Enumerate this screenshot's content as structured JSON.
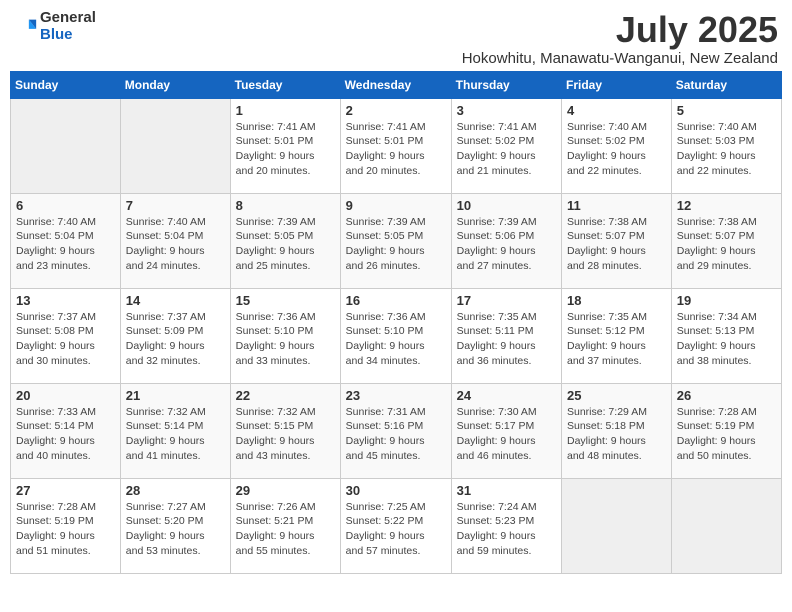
{
  "header": {
    "logo": {
      "line1": "General",
      "line2": "Blue"
    },
    "month": "July 2025",
    "location": "Hokowhitu, Manawatu-Wanganui, New Zealand"
  },
  "columns": [
    "Sunday",
    "Monday",
    "Tuesday",
    "Wednesday",
    "Thursday",
    "Friday",
    "Saturday"
  ],
  "weeks": [
    [
      {
        "day": "",
        "info": ""
      },
      {
        "day": "",
        "info": ""
      },
      {
        "day": "1",
        "info": "Sunrise: 7:41 AM\nSunset: 5:01 PM\nDaylight: 9 hours\nand 20 minutes."
      },
      {
        "day": "2",
        "info": "Sunrise: 7:41 AM\nSunset: 5:01 PM\nDaylight: 9 hours\nand 20 minutes."
      },
      {
        "day": "3",
        "info": "Sunrise: 7:41 AM\nSunset: 5:02 PM\nDaylight: 9 hours\nand 21 minutes."
      },
      {
        "day": "4",
        "info": "Sunrise: 7:40 AM\nSunset: 5:02 PM\nDaylight: 9 hours\nand 22 minutes."
      },
      {
        "day": "5",
        "info": "Sunrise: 7:40 AM\nSunset: 5:03 PM\nDaylight: 9 hours\nand 22 minutes."
      }
    ],
    [
      {
        "day": "6",
        "info": "Sunrise: 7:40 AM\nSunset: 5:04 PM\nDaylight: 9 hours\nand 23 minutes."
      },
      {
        "day": "7",
        "info": "Sunrise: 7:40 AM\nSunset: 5:04 PM\nDaylight: 9 hours\nand 24 minutes."
      },
      {
        "day": "8",
        "info": "Sunrise: 7:39 AM\nSunset: 5:05 PM\nDaylight: 9 hours\nand 25 minutes."
      },
      {
        "day": "9",
        "info": "Sunrise: 7:39 AM\nSunset: 5:05 PM\nDaylight: 9 hours\nand 26 minutes."
      },
      {
        "day": "10",
        "info": "Sunrise: 7:39 AM\nSunset: 5:06 PM\nDaylight: 9 hours\nand 27 minutes."
      },
      {
        "day": "11",
        "info": "Sunrise: 7:38 AM\nSunset: 5:07 PM\nDaylight: 9 hours\nand 28 minutes."
      },
      {
        "day": "12",
        "info": "Sunrise: 7:38 AM\nSunset: 5:07 PM\nDaylight: 9 hours\nand 29 minutes."
      }
    ],
    [
      {
        "day": "13",
        "info": "Sunrise: 7:37 AM\nSunset: 5:08 PM\nDaylight: 9 hours\nand 30 minutes."
      },
      {
        "day": "14",
        "info": "Sunrise: 7:37 AM\nSunset: 5:09 PM\nDaylight: 9 hours\nand 32 minutes."
      },
      {
        "day": "15",
        "info": "Sunrise: 7:36 AM\nSunset: 5:10 PM\nDaylight: 9 hours\nand 33 minutes."
      },
      {
        "day": "16",
        "info": "Sunrise: 7:36 AM\nSunset: 5:10 PM\nDaylight: 9 hours\nand 34 minutes."
      },
      {
        "day": "17",
        "info": "Sunrise: 7:35 AM\nSunset: 5:11 PM\nDaylight: 9 hours\nand 36 minutes."
      },
      {
        "day": "18",
        "info": "Sunrise: 7:35 AM\nSunset: 5:12 PM\nDaylight: 9 hours\nand 37 minutes."
      },
      {
        "day": "19",
        "info": "Sunrise: 7:34 AM\nSunset: 5:13 PM\nDaylight: 9 hours\nand 38 minutes."
      }
    ],
    [
      {
        "day": "20",
        "info": "Sunrise: 7:33 AM\nSunset: 5:14 PM\nDaylight: 9 hours\nand 40 minutes."
      },
      {
        "day": "21",
        "info": "Sunrise: 7:32 AM\nSunset: 5:14 PM\nDaylight: 9 hours\nand 41 minutes."
      },
      {
        "day": "22",
        "info": "Sunrise: 7:32 AM\nSunset: 5:15 PM\nDaylight: 9 hours\nand 43 minutes."
      },
      {
        "day": "23",
        "info": "Sunrise: 7:31 AM\nSunset: 5:16 PM\nDaylight: 9 hours\nand 45 minutes."
      },
      {
        "day": "24",
        "info": "Sunrise: 7:30 AM\nSunset: 5:17 PM\nDaylight: 9 hours\nand 46 minutes."
      },
      {
        "day": "25",
        "info": "Sunrise: 7:29 AM\nSunset: 5:18 PM\nDaylight: 9 hours\nand 48 minutes."
      },
      {
        "day": "26",
        "info": "Sunrise: 7:28 AM\nSunset: 5:19 PM\nDaylight: 9 hours\nand 50 minutes."
      }
    ],
    [
      {
        "day": "27",
        "info": "Sunrise: 7:28 AM\nSunset: 5:19 PM\nDaylight: 9 hours\nand 51 minutes."
      },
      {
        "day": "28",
        "info": "Sunrise: 7:27 AM\nSunset: 5:20 PM\nDaylight: 9 hours\nand 53 minutes."
      },
      {
        "day": "29",
        "info": "Sunrise: 7:26 AM\nSunset: 5:21 PM\nDaylight: 9 hours\nand 55 minutes."
      },
      {
        "day": "30",
        "info": "Sunrise: 7:25 AM\nSunset: 5:22 PM\nDaylight: 9 hours\nand 57 minutes."
      },
      {
        "day": "31",
        "info": "Sunrise: 7:24 AM\nSunset: 5:23 PM\nDaylight: 9 hours\nand 59 minutes."
      },
      {
        "day": "",
        "info": ""
      },
      {
        "day": "",
        "info": ""
      }
    ]
  ]
}
